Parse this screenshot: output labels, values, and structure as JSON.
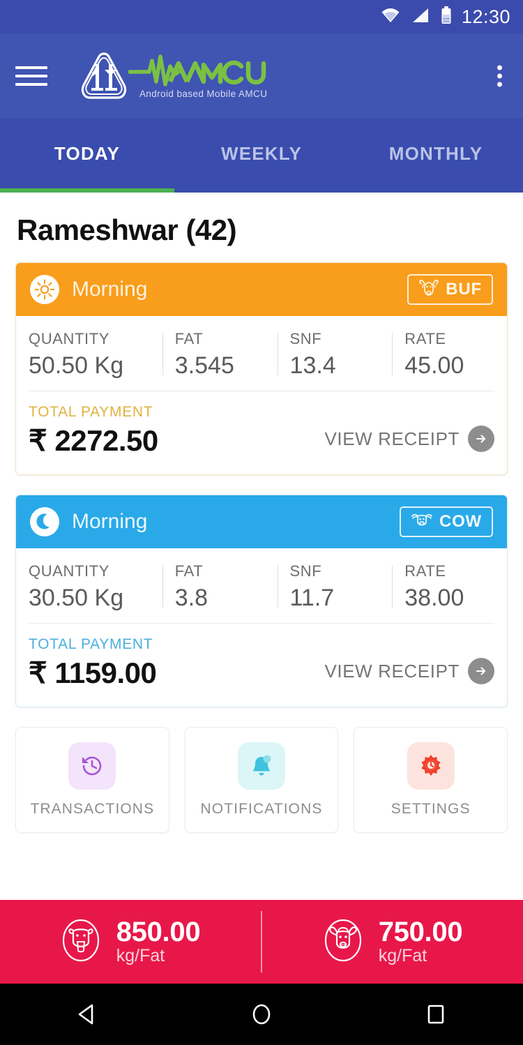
{
  "status_bar": {
    "time": "12:30",
    "icons": [
      "wifi-icon",
      "signal-icon",
      "battery-icon"
    ]
  },
  "app_bar": {
    "menu_icon": "hamburger-menu-icon",
    "logo_icon": "amcu-triangle-logo-icon",
    "brand_name": "AMCU",
    "brand_tagline": "Android based Mobile AMCU",
    "overflow_icon": "kebab-menu-icon",
    "brand_color": "#7ac143",
    "bar_color": "#4054b2"
  },
  "tabs": {
    "items": [
      {
        "label": "TODAY",
        "active": true
      },
      {
        "label": "WEEKLY",
        "active": false
      },
      {
        "label": "MONTHLY",
        "active": false
      }
    ],
    "indicator_color": "#4caf50"
  },
  "main": {
    "farmer_title": "Rameshwar (42)",
    "cards": [
      {
        "session": "Morning",
        "session_icon": "sun-icon",
        "animal": "BUF",
        "animal_icon": "buffalo-head-icon",
        "accent": "#f99d1c",
        "metrics": [
          {
            "label": "QUANTITY",
            "value": "50.50 Kg"
          },
          {
            "label": "FAT",
            "value": "3.545"
          },
          {
            "label": "SNF",
            "value": "13.4"
          },
          {
            "label": "RATE",
            "value": "45.00"
          }
        ],
        "payment_label": "TOTAL PAYMENT",
        "payment_amount": "₹ 2272.50",
        "receipt_label": "VIEW RECEIPT",
        "receipt_icon": "arrow-right-circle-icon"
      },
      {
        "session": "Morning",
        "session_icon": "moon-icon",
        "animal": "COW",
        "animal_icon": "cow-head-icon",
        "accent": "#29a9e8",
        "metrics": [
          {
            "label": "QUANTITY",
            "value": "30.50 Kg"
          },
          {
            "label": "FAT",
            "value": "3.8"
          },
          {
            "label": "SNF",
            "value": "11.7"
          },
          {
            "label": "RATE",
            "value": "38.00"
          }
        ],
        "payment_label": "TOTAL PAYMENT",
        "payment_amount": "₹ 1159.00",
        "receipt_label": "VIEW RECEIPT",
        "receipt_icon": "arrow-right-circle-icon"
      }
    ],
    "tiles": [
      {
        "label": "TRANSACTIONS",
        "icon": "history-clock-icon",
        "icon_color": "#a855d6",
        "bg": "#f3e4fb"
      },
      {
        "label": "NOTIFICATIONS",
        "icon": "bell-icon",
        "icon_color": "#3fc3dd",
        "bg": "#dcf6f7"
      },
      {
        "label": "SETTINGS",
        "icon": "gear-clock-icon",
        "icon_color": "#f0412a",
        "bg": "#fde3dd"
      }
    ]
  },
  "rate_bar": {
    "bg": "#e8174a",
    "items": [
      {
        "icon": "cow-circle-icon",
        "value": "850.00",
        "unit": "kg/Fat"
      },
      {
        "icon": "buffalo-circle-icon",
        "value": "750.00",
        "unit": "kg/Fat"
      }
    ]
  },
  "nav_bar": {
    "back_icon": "back-triangle-icon",
    "home_icon": "home-circle-icon",
    "recents_icon": "recents-square-icon"
  }
}
